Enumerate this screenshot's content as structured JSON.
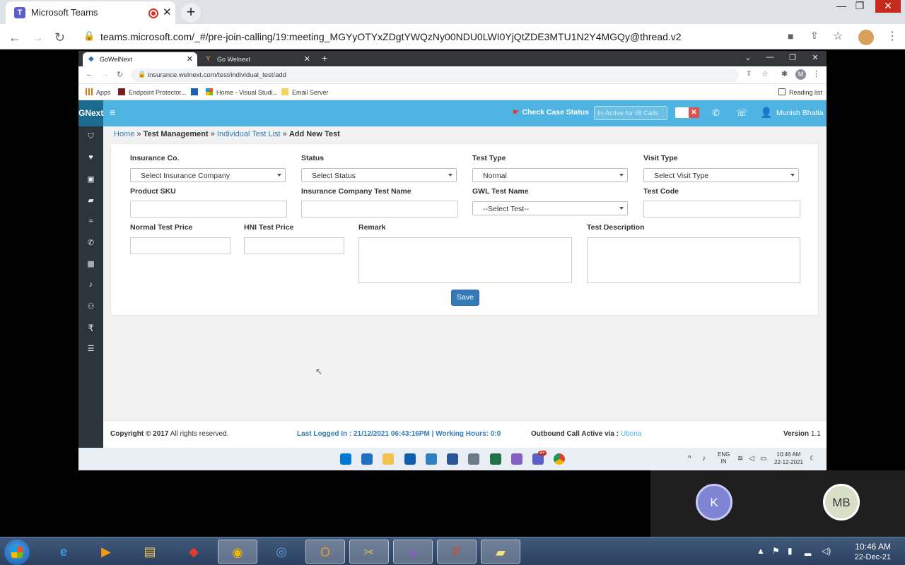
{
  "outer_browser": {
    "tab_title": "Microsoft Teams",
    "url": "teams.microsoft.com/_#/pre-join-calling/19:meeting_MGYyOTYxZDgtYWQzNy00NDU0LWI0YjQtZDE3MTU1N2Y4MGQy@thread.v2"
  },
  "inner_browser": {
    "tabs": [
      {
        "label": "GoWelNext"
      },
      {
        "label": "Go Welnext"
      }
    ],
    "url": "insurance.welnext.com/test/individual_test/add",
    "profile_initial": "M",
    "bookmarks": {
      "apps": "Apps",
      "endpoint": "Endpoint Protector...",
      "home": "Home - Visual Studi...",
      "email": "Email Server",
      "reading_list": "Reading list"
    }
  },
  "app": {
    "brand": "GNext",
    "check_case": "Check Case Status",
    "ib_status_placeholder": "In-Active for IB Calls",
    "user_name": "Munish Bhatia",
    "breadcrumb": {
      "home": "Home",
      "sep1": " » ",
      "test_management": "Test Management",
      "sep2": " » ",
      "individual_list": "Individual Test List",
      "sep3": " » ",
      "current": "Add New Test"
    },
    "form": {
      "insurance_label": "Insurance Co.",
      "insurance_value": "Select Insurance Company",
      "status_label": "Status",
      "status_value": "Select Status",
      "test_type_label": "Test Type",
      "test_type_value": "Normal",
      "visit_type_label": "Visit Type",
      "visit_type_value": "Select Visit Type",
      "sku_label": "Product SKU",
      "ic_test_name_label": "Insurance Company Test Name",
      "gwl_test_name_label": "GWL Test Name",
      "gwl_test_value": "--Select Test--",
      "test_code_label": "Test Code",
      "normal_price_label": "Normal Test Price",
      "hni_price_label": "HNI Test Price",
      "remark_label": "Remark",
      "description_label": "Test Description",
      "save_label": "Save"
    },
    "footer": {
      "copyright_bold": "Copyright © 2017",
      "copyright_rest": " All rights reserved.",
      "last_logged": "Last Logged In : 21/12/2021 06:43:16PM | Working Hours: 0:0",
      "outbound_label": "Outbound Call Active via : ",
      "outbound_value": "Ubona",
      "version_label": "Version",
      "version_value": " 1.1"
    }
  },
  "win11_tray": {
    "lang_top": "ENG",
    "lang_bottom": "IN",
    "time": "10:46 AM",
    "date": "22-12-2021",
    "badge": "9+"
  },
  "call": {
    "participant1": "K",
    "participant2": "MB"
  },
  "win7": {
    "time": "10:46 AM",
    "date": "22-Dec-21"
  },
  "colors": {
    "header": "#4fb4e2",
    "sidebar": "#2d353c",
    "link": "#337ab7",
    "save": "#337ab7"
  }
}
